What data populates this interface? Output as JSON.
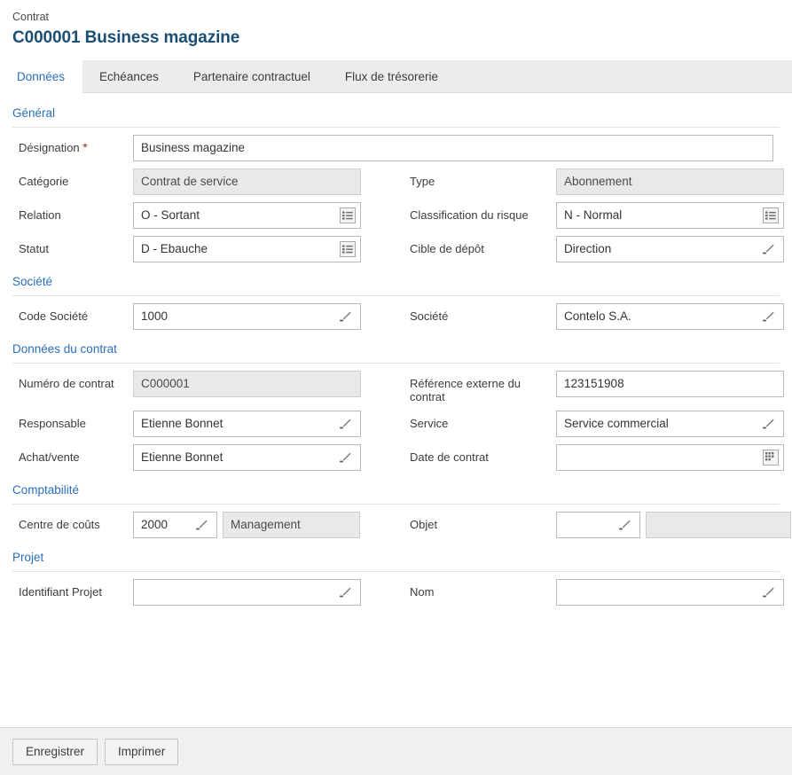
{
  "header": {
    "breadcrumb": "Contrat",
    "title": "C000001 Business magazine"
  },
  "tabs": [
    {
      "label": "Données",
      "active": true
    },
    {
      "label": "Echéances",
      "active": false
    },
    {
      "label": "Partenaire contractuel",
      "active": false
    },
    {
      "label": "Flux de trésorerie",
      "active": false
    }
  ],
  "sections": {
    "general": {
      "title": "Général",
      "designation_label": "Désignation",
      "designation_required": "*",
      "designation_value": "Business magazine",
      "categorie_label": "Catégorie",
      "categorie_value": "Contrat de service",
      "type_label": "Type",
      "type_value": "Abonnement",
      "relation_label": "Relation",
      "relation_value": "O - Sortant",
      "risque_label": "Classification du risque",
      "risque_value": "N - Normal",
      "statut_label": "Statut",
      "statut_value": "D - Ebauche",
      "cible_label": "Cible de dépôt",
      "cible_value": "Direction"
    },
    "societe": {
      "title": "Société",
      "code_label": "Code Société",
      "code_value": "1000",
      "societe_label": "Société",
      "societe_value": "Contelo S.A."
    },
    "contrat": {
      "title": "Données du contrat",
      "numero_label": "Numéro de contrat",
      "numero_value": "C000001",
      "reference_label": "Référence externe du contrat",
      "reference_value": "123151908",
      "responsable_label": "Responsable",
      "responsable_value": "Etienne Bonnet",
      "service_label": "Service",
      "service_value": "Service commercial",
      "achat_label": "Achat/vente",
      "achat_value": "Etienne Bonnet",
      "date_label": "Date de contrat",
      "date_value": ""
    },
    "comptabilite": {
      "title": "Comptabilité",
      "centre_label": "Centre de coûts",
      "centre_value": "2000",
      "centre_text": "Management",
      "objet_label": "Objet",
      "objet_value": "",
      "objet_text": ""
    },
    "projet": {
      "title": "Projet",
      "identifiant_label": "Identifiant Projet",
      "identifiant_value": "",
      "nom_label": "Nom",
      "nom_value": ""
    }
  },
  "footer": {
    "save_label": "Enregistrer",
    "print_label": "Imprimer"
  },
  "icons": {
    "value_help": "list-icon",
    "edit": "pencil-icon",
    "calendar": "calendar-icon"
  },
  "colors": {
    "accent": "#2a6ebb",
    "title": "#1b4f72",
    "required": "#9b2226",
    "tabbar_bg": "#ececec",
    "readonly_bg": "#e9e9e9",
    "footer_bg": "#f0f0f0"
  }
}
